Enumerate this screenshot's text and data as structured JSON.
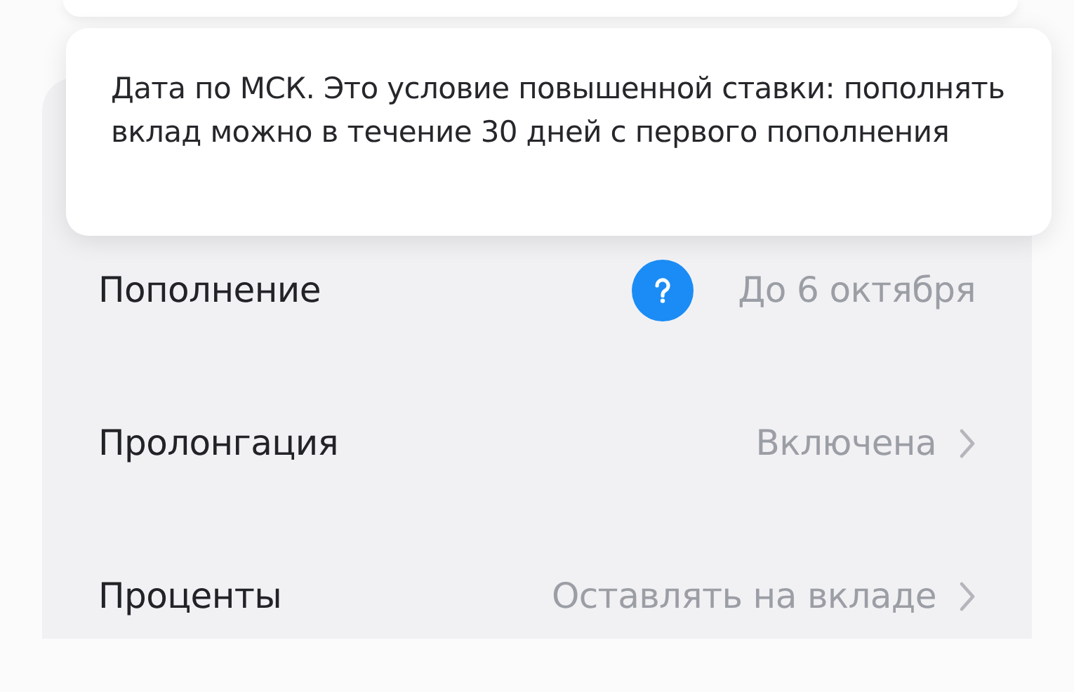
{
  "tooltip": {
    "text": "Дата по МСК. Это условие повышенной ставки: пополнять вклад можно в течение 30 дней с первого пополнения"
  },
  "rows": [
    {
      "label": "Пополнение",
      "value": "До 6 октября",
      "kind": "info"
    },
    {
      "label": "Пролонгация",
      "value": "Включена",
      "kind": "link"
    },
    {
      "label": "Проценты",
      "value": "Оставлять на вкладе",
      "kind": "link"
    }
  ]
}
